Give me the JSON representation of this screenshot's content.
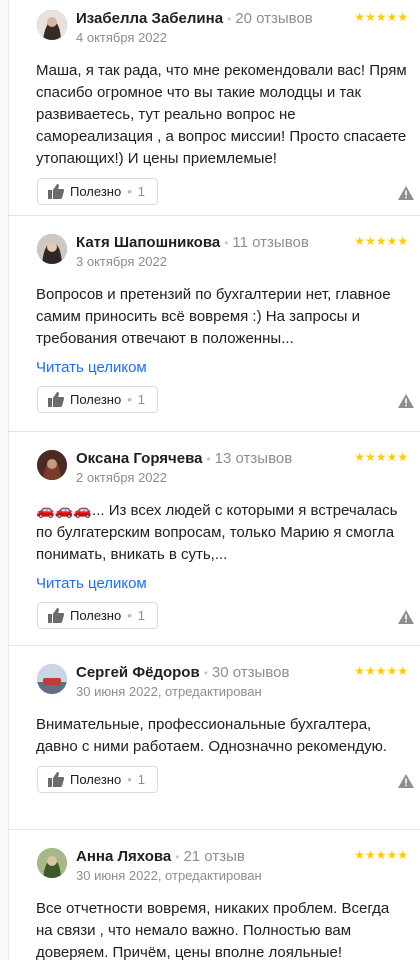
{
  "reviews": [
    {
      "author": "Изабелла Забелина",
      "count": "20 отзывов",
      "date": "4 октября 2022",
      "stars": "★★★★★",
      "text": "Маша, я так рада, что мне рекомендовали вас! Прям спасибо огромное что вы такие молодцы и так развиваетесь, тут реально вопрос не самореализация , а вопрос миссии! Просто спасаете утопающих!) И цены приемлемые!",
      "more": "",
      "useful_label": "Полезно",
      "useful_count": "1",
      "avatar_color": "#7a5c4f"
    },
    {
      "author": "Катя Шапошникова",
      "count": "11 отзывов",
      "date": "3 октября 2022",
      "stars": "★★★★★",
      "text": "Вопросов и претензий по бухгалтерии нет, главное самим приносить всё вовремя :) На запросы и требования отвечают в положенны...",
      "more": "Читать целиком",
      "useful_label": "Полезно",
      "useful_count": "1",
      "avatar_color": "#6b6464"
    },
    {
      "author": "Оксана Горячева",
      "count": "13 отзывов",
      "date": "2 октября 2022",
      "stars": "★★★★★",
      "text": "🚗🚗🚗... Из всех людей с которыми я встречалась по булгатерским вопросам, только Марию я смогла понимать, вникать в суть,...",
      "more": "Читать целиком",
      "useful_label": "Полезно",
      "useful_count": "1",
      "avatar_color": "#5a2e24"
    },
    {
      "author": "Сергей Фёдоров",
      "count": "30 отзывов",
      "date": "30 июня 2022, отредактирован",
      "stars": "★★★★★",
      "text": "Внимательные, профессиональные бухгалтера, давно с ними работаем. Однозначно рекомендую.",
      "more": "",
      "useful_label": "Полезно",
      "useful_count": "1",
      "avatar_color": "#9aa8b8"
    },
    {
      "author": "Анна Ляхова",
      "count": "21 отзыв",
      "date": "30 июня 2022, отредактирован",
      "stars": "★★★★★",
      "text": "Все отчетности вовремя, никаких проблем. Всегда на связи , что немало важно. Полностью вам доверяем. Причём, цены вполне лояльные!",
      "more": "",
      "useful_label": "",
      "useful_count": "",
      "avatar_color": "#6f8a52"
    }
  ]
}
